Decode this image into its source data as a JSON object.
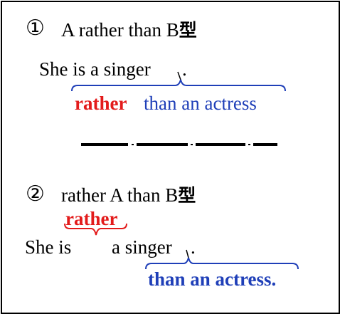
{
  "section1": {
    "marker": "①",
    "title": "A rather than B",
    "title_suffix": "型",
    "sentence": "She is a singer",
    "period": ".",
    "phrase_rather": "rather",
    "phrase_than": "than an actress"
  },
  "section2": {
    "marker": "②",
    "title": "rather A than B",
    "title_suffix": "型",
    "rather": "rather",
    "sentence_she_is": "She is",
    "sentence_a_singer": "a singer",
    "period": ".",
    "phrase_than": "than an actress."
  },
  "colors": {
    "rather_red": "#e31b1b",
    "than_blue": "#1f3fb8",
    "brace_blue": "#1f3fb8",
    "brace_red": "#e31b1b"
  }
}
